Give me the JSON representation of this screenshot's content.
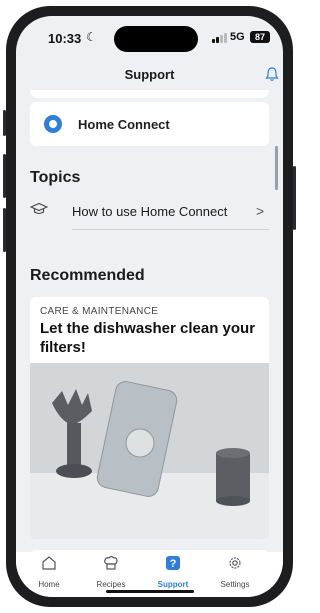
{
  "status_bar": {
    "time": "10:33",
    "moon": "☾",
    "network": "5G",
    "battery": "87"
  },
  "header": {
    "title": "Support"
  },
  "home_connect_card": {
    "label": "Home Connect"
  },
  "topics": {
    "heading": "Topics",
    "items": [
      {
        "label": "How to use Home Connect",
        "chevron": ">"
      }
    ]
  },
  "recommended": {
    "heading": "Recommended",
    "card": {
      "category": "CARE & MAINTENANCE",
      "title": "Let the dishwasher clean your filters!"
    }
  },
  "tabbar": {
    "items": [
      {
        "label": "Home",
        "icon": "home-icon"
      },
      {
        "label": "Recipes",
        "icon": "chef-hat-icon"
      },
      {
        "label": "Support",
        "icon": "support-icon"
      },
      {
        "label": "Settings",
        "icon": "gear-icon"
      }
    ],
    "active": "Support",
    "accent": "#2f7ed8"
  }
}
